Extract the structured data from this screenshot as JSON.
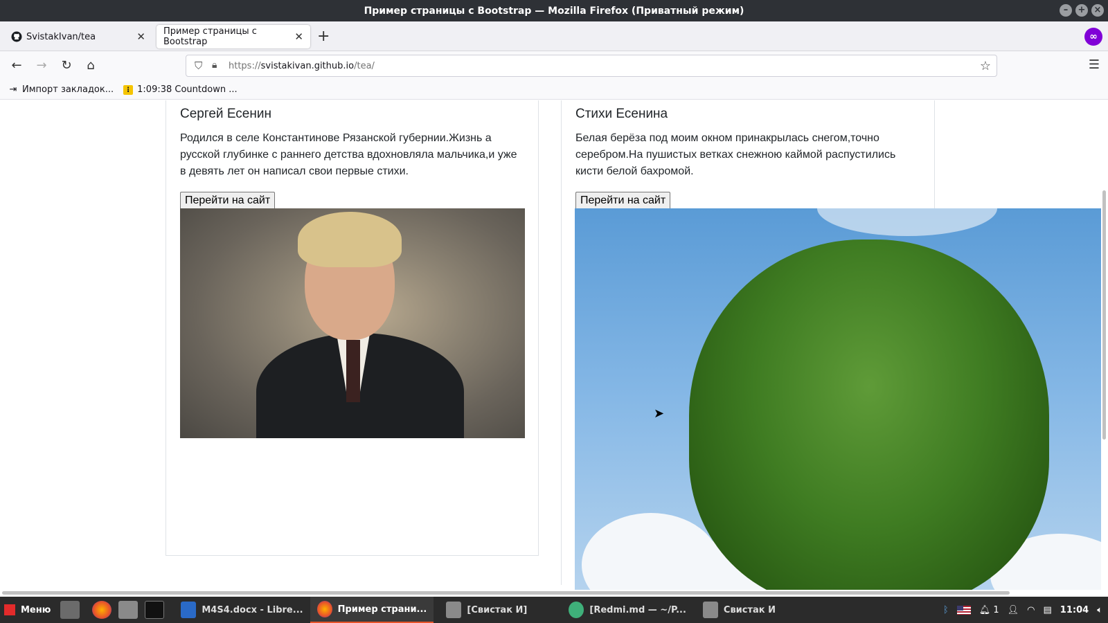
{
  "window": {
    "title": "Пример страницы с Bootstrap — Mozilla Firefox (Приватный режим)"
  },
  "tabs": [
    {
      "label": "SvistakIvan/tea",
      "icon": "github-icon",
      "active": false
    },
    {
      "label": "Пример страницы с Bootstrap",
      "icon": "none",
      "active": true
    }
  ],
  "navbar": {
    "url_proto": "https://",
    "url_host": "svistakivan.github.io",
    "url_path": "/tea/"
  },
  "bookmarks": [
    {
      "label": "Импорт закладок...",
      "icon": "import-icon"
    },
    {
      "label": "1:09:38 Countdown ...",
      "icon": "countdown-icon"
    }
  ],
  "cards": [
    {
      "title": "Сергей Есенин",
      "text": "Родился в селе Константинове Рязанской губернии.Жизнь а русской глубинке с раннего детства вдохновляла мальчика,и уже в девять лет он написал свои первые стихи.",
      "button": "Перейти на сайт",
      "image": "portrait of Sergei Yesenin"
    },
    {
      "title": "Стихи Есенина",
      "text": "Белая берёза под моим окном принакрылась снегом,точно серебром.На пушистых ветках снежною каймой распустились кисти белой бахромой.",
      "button": "Перейти на сайт",
      "image": "birch tree against blue sky"
    }
  ],
  "taskbar": {
    "menu_label": "Меню",
    "items": [
      {
        "label": "M4S4.docx - Libre...",
        "active": false
      },
      {
        "label": "Пример страни...",
        "active": true
      },
      {
        "label": "[Свистак И]",
        "active": false
      },
      {
        "label": "[Redmi.md — ~/P...",
        "active": false
      },
      {
        "label": "Свистак И",
        "active": false
      }
    ],
    "tray": {
      "notifications": "1",
      "clock": "11:04"
    }
  },
  "colors": {
    "accent": "#e8542a",
    "private": "#8000d7"
  }
}
